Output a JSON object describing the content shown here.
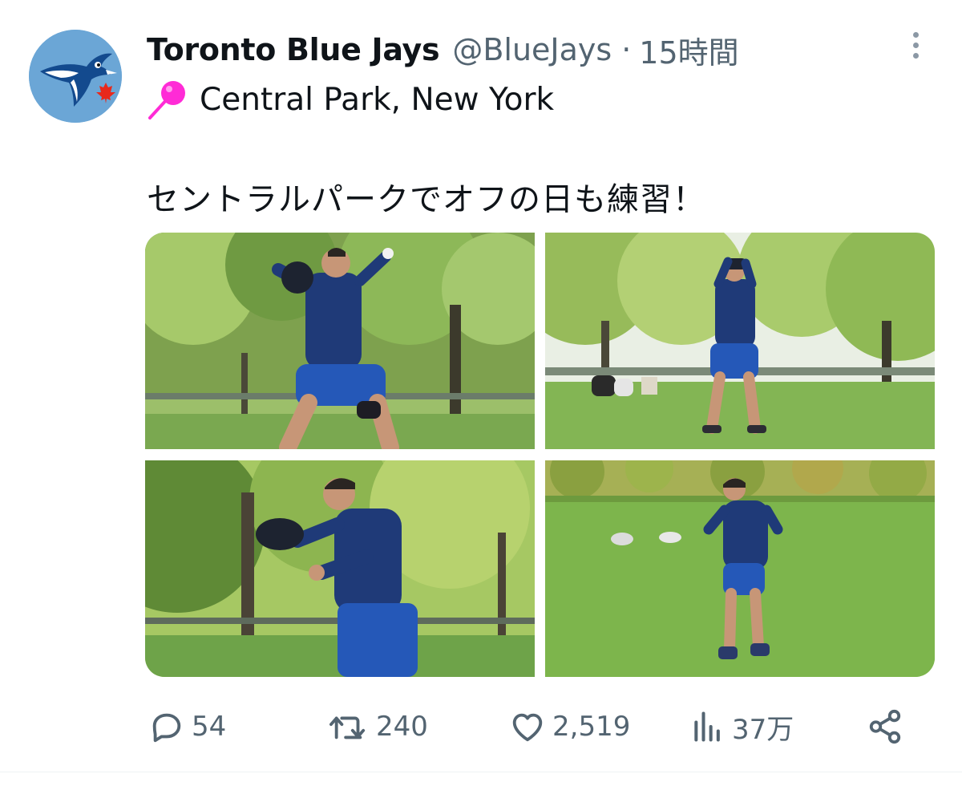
{
  "tweet": {
    "display_name": "Toronto Blue Jays",
    "handle": "@BlueJays",
    "separator": "·",
    "timestamp": "15時間",
    "location": "Central Park, New York",
    "text": "セントラルパークでオフの日も練習！"
  },
  "media": {
    "photos": [
      "pitching-motion",
      "overhead-windup",
      "catching-ball",
      "running-on-grass"
    ]
  },
  "actions": {
    "replies": "54",
    "retweets": "240",
    "likes": "2,519",
    "views": "37万"
  },
  "icons": {
    "avatar": "blue-jays-logo-icon",
    "more": "more-vertical-icon",
    "location": "pin-icon",
    "reply": "reply-icon",
    "retweet": "retweet-icon",
    "like": "heart-icon",
    "views": "views-icon",
    "share": "share-icon"
  },
  "colors": {
    "text": "#0f1419",
    "muted": "#536471",
    "avatar_bg": "#6ba6d6",
    "pin": "#ff2bd6",
    "jays_blue": "#134a8e",
    "maple_red": "#e8291c"
  }
}
